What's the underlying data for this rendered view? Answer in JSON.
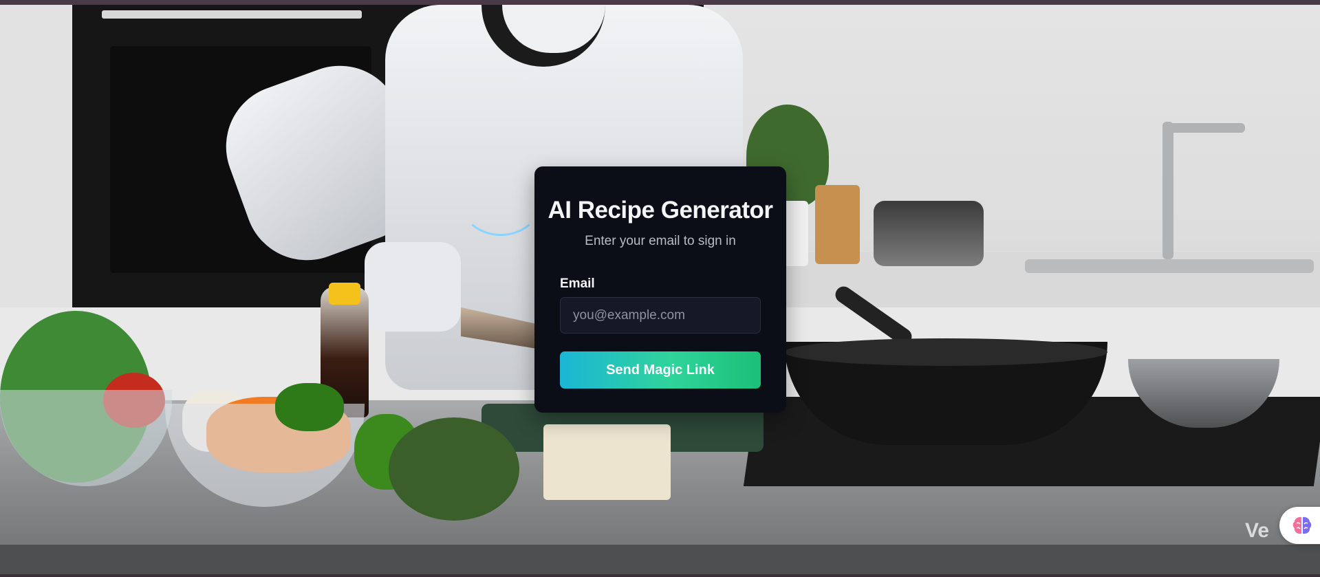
{
  "login": {
    "title": "AI Recipe Generator",
    "subtitle": "Enter your email to sign in",
    "email_label": "Email",
    "email_placeholder": "you@example.com",
    "email_value": "",
    "submit_label": "Send Magic Link"
  },
  "background": {
    "watermark": "Ve"
  },
  "badge": {
    "icon": "brain-icon"
  },
  "colors": {
    "card_bg": "#0b0e16",
    "button_gradient_start": "#1bb6d6",
    "button_gradient_end": "#1cbf78",
    "top_bar": "#4a3a48"
  }
}
